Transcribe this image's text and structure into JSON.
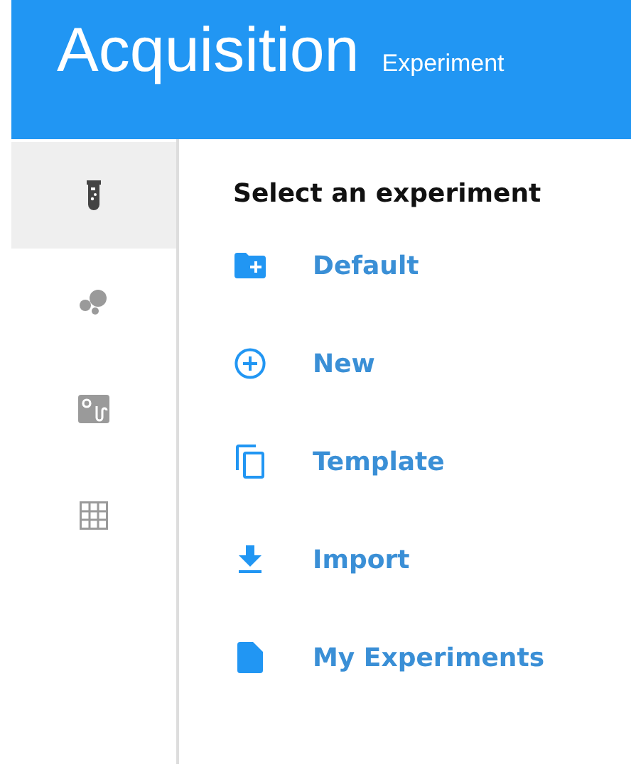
{
  "header": {
    "title": "Acquisition",
    "subtitle": "Experiment"
  },
  "sidebar": {
    "items": [
      {
        "kind": "tube",
        "selected": true
      },
      {
        "kind": "bubbles",
        "selected": false
      },
      {
        "kind": "instrument",
        "selected": false
      },
      {
        "kind": "grid",
        "selected": false
      }
    ]
  },
  "content": {
    "heading": "Select an experiment",
    "actions": [
      {
        "kind": "folder-add",
        "label": "Default"
      },
      {
        "kind": "add-circle",
        "label": "New"
      },
      {
        "kind": "copy",
        "label": "Template"
      },
      {
        "kind": "download",
        "label": "Import"
      },
      {
        "kind": "document",
        "label": "My Experiments"
      }
    ]
  }
}
